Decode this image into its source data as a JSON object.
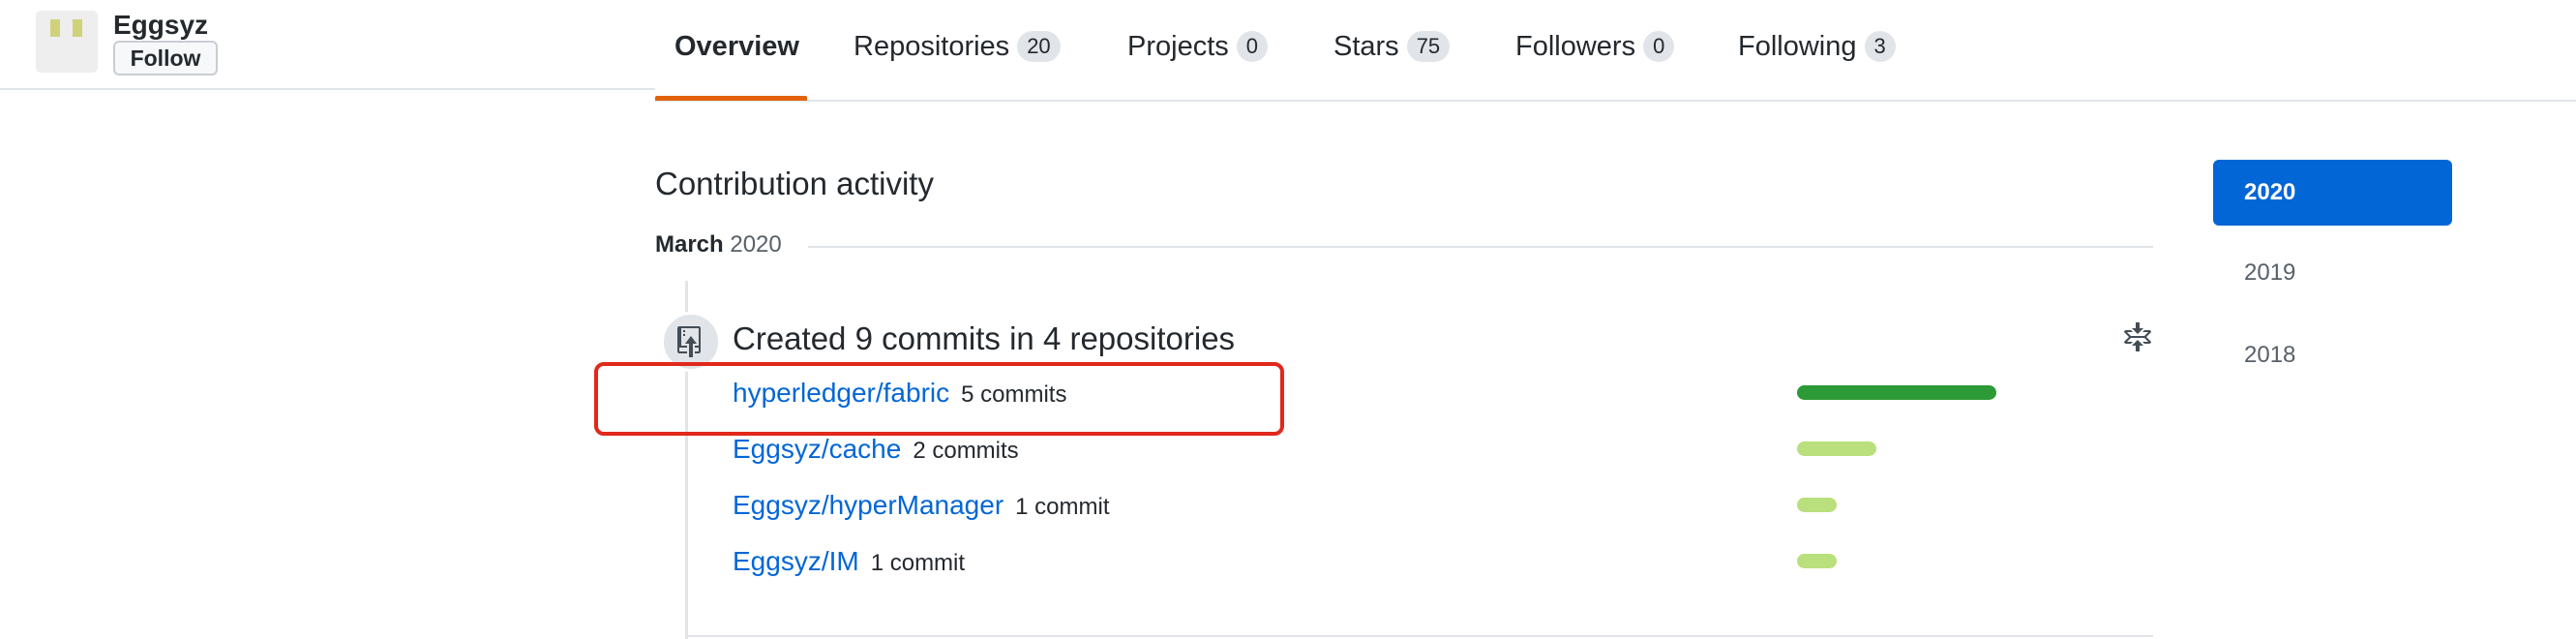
{
  "profile": {
    "username": "Eggsyz",
    "follow_label": "Follow"
  },
  "tabs": [
    {
      "label": "Overview",
      "count": null,
      "selected": true
    },
    {
      "label": "Repositories",
      "count": "20"
    },
    {
      "label": "Projects",
      "count": "0"
    },
    {
      "label": "Stars",
      "count": "75"
    },
    {
      "label": "Followers",
      "count": "0"
    },
    {
      "label": "Following",
      "count": "3"
    }
  ],
  "activity": {
    "section_title": "Contribution activity",
    "month": "March",
    "year": "2020",
    "event_title": "Created 9 commits in 4 repositories",
    "repos": [
      {
        "name": "hyperledger/fabric",
        "commits": "5 commits",
        "bar_fraction": 1.0,
        "bar_color": "#2c9a36",
        "highlighted": true
      },
      {
        "name": "Eggsyz/cache",
        "commits": "2 commits",
        "bar_fraction": 0.4,
        "bar_color": "#b9e07c"
      },
      {
        "name": "Eggsyz/hyperManager",
        "commits": "1 commit",
        "bar_fraction": 0.2,
        "bar_color": "#b9e07c"
      },
      {
        "name": "Eggsyz/IM",
        "commits": "1 commit",
        "bar_fraction": 0.2,
        "bar_color": "#b9e07c"
      }
    ],
    "event_icon": "repo-push-icon",
    "fold_icon": "fold-icon"
  },
  "years": {
    "selected": "2020",
    "others": [
      "2019",
      "2018"
    ]
  },
  "colors": {
    "accent": "#0366d6",
    "tab_underline": "#e36209",
    "highlight_box": "#e0281b"
  }
}
